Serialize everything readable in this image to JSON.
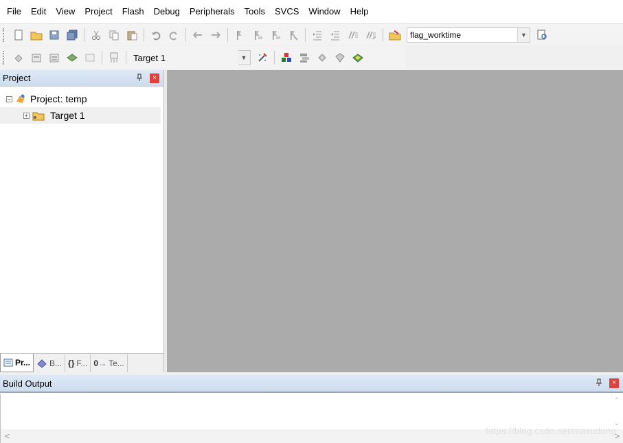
{
  "menu": [
    "File",
    "Edit",
    "View",
    "Project",
    "Flash",
    "Debug",
    "Peripherals",
    "Tools",
    "SVCS",
    "Window",
    "Help"
  ],
  "toolbar1": {
    "buttons": [
      "new-file-icon",
      "open-folder-icon",
      "save-icon",
      "save-all-icon",
      "cut-icon",
      "copy-icon",
      "paste-icon",
      "undo-icon",
      "redo-icon",
      "nav-back-icon",
      "nav-forward-icon",
      "bookmark-toggle-icon",
      "bookmark-prev-icon",
      "bookmark-next-icon",
      "bookmark-clear-icon",
      "indent-icon",
      "unindent-icon",
      "comment-icon",
      "uncomment-icon",
      "find-in-files-icon"
    ],
    "find_value": "flag_worktime"
  },
  "toolbar2": {
    "buttons": [
      "translate-icon",
      "build-icon",
      "rebuild-icon",
      "batch-build-icon",
      "stop-build-icon",
      "download-icon"
    ],
    "target_label": "Target 1",
    "after_buttons": [
      "target-options-icon",
      "manage-components-icon",
      "select-packs-icon",
      "pack-installer-icon",
      "run-time-env-icon"
    ]
  },
  "project_panel": {
    "title": "Project",
    "pin_glyph": "♐",
    "close_glyph": "×",
    "tree": {
      "root": "Project: temp",
      "child": "Target 1"
    },
    "tabs": [
      "Pr...",
      "B...",
      "F...",
      "Te..."
    ]
  },
  "build_output": {
    "title": "Build Output",
    "pin_glyph": "♐",
    "close_glyph": "×",
    "scroll_left": "<",
    "scroll_right": ">",
    "watermark": "https://blog.csdn.net/masudong"
  },
  "colors": {
    "editor_bg": "#ababab",
    "panel_header": "#dfe9f5",
    "close_red": "#e0413b"
  }
}
